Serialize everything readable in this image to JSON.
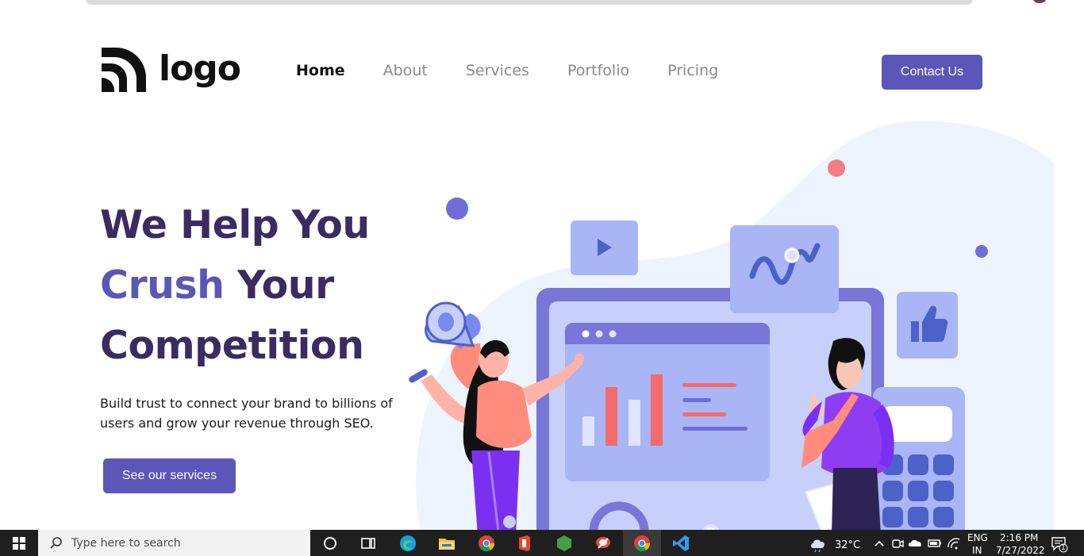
{
  "header": {
    "logo_text": "logo",
    "nav": [
      {
        "label": "Home",
        "active": true
      },
      {
        "label": "About",
        "active": false
      },
      {
        "label": "Services",
        "active": false
      },
      {
        "label": "Portfolio",
        "active": false
      },
      {
        "label": "Pricing",
        "active": false
      }
    ],
    "contact_label": "Contact Us"
  },
  "hero": {
    "line1": "We Help You",
    "line2_accent": "Crush",
    "line2_rest": " Your",
    "line3": "Competition",
    "description": "Build trust to connect your brand to billions of users and grow your revenue through SEO.",
    "cta_label": "See our services"
  },
  "colors": {
    "brand": "#5b56b8",
    "heading": "#3b2b62",
    "accent": "#5c56b6",
    "blob": "#eef4fe"
  },
  "taskbar": {
    "search_placeholder": "Type here to search",
    "weather": "32°C",
    "language_line1": "ENG",
    "language_line2": "IN",
    "time": "2:16 PM",
    "date": "7/27/2022",
    "notification_count": "1",
    "apps": [
      "cortana-icon",
      "task-view-icon",
      "edge-icon",
      "file-explorer-icon",
      "chrome-icon",
      "office-icon",
      "nodejs-icon",
      "app-icon",
      "chrome-icon",
      "vscode-icon"
    ]
  }
}
